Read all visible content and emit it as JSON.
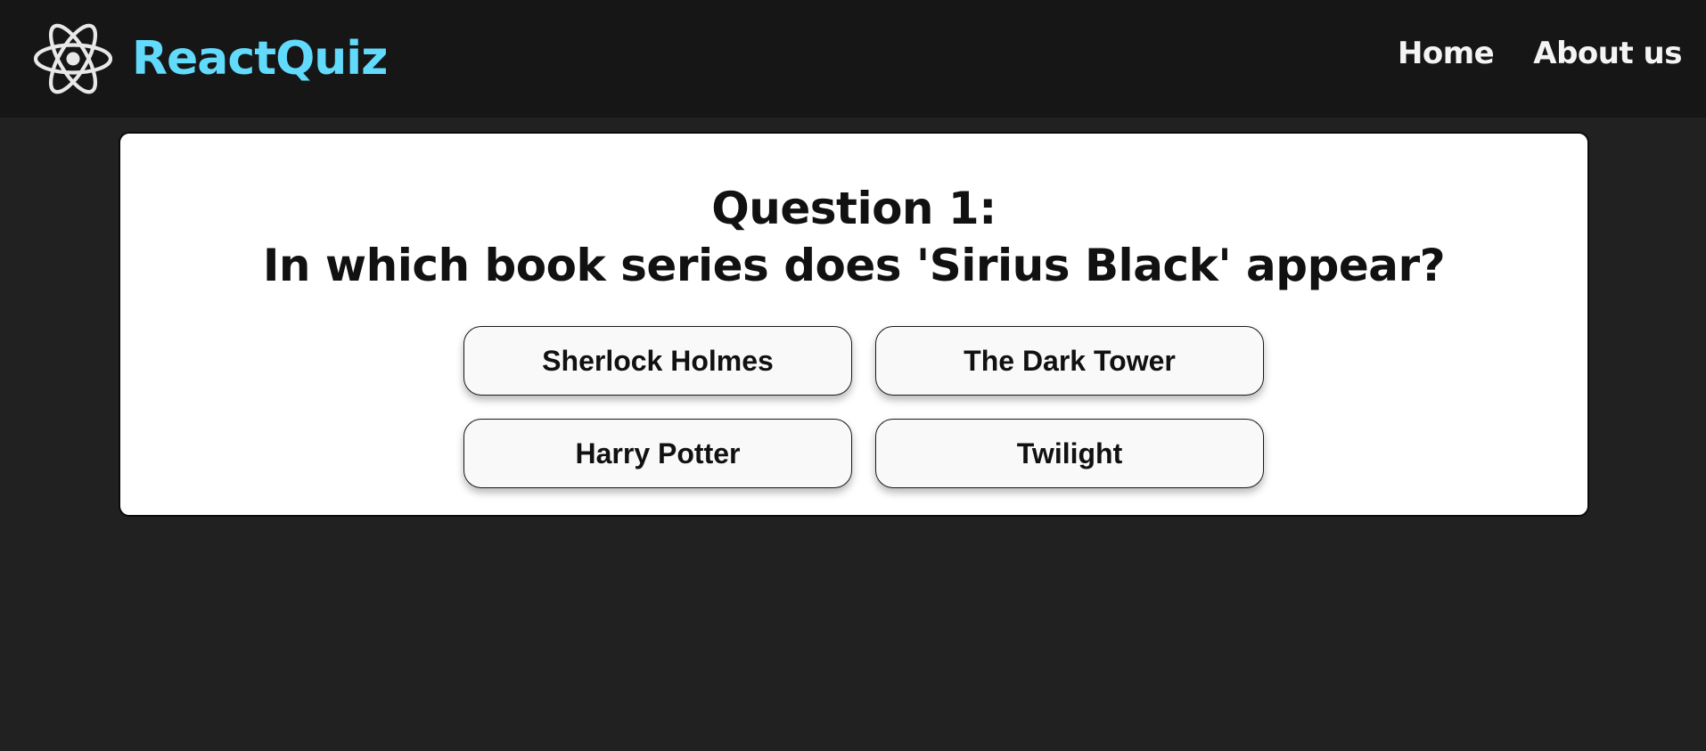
{
  "header": {
    "brand": "ReactQuiz",
    "logo_icon": "react-atom-icon",
    "nav": [
      {
        "label": "Home"
      },
      {
        "label": "About us"
      }
    ]
  },
  "quiz": {
    "question_number": "Question 1:",
    "question_text": "In which book series does 'Sirius Black' appear?",
    "answers": [
      {
        "label": "Sherlock Holmes"
      },
      {
        "label": "The Dark Tower"
      },
      {
        "label": "Harry Potter"
      },
      {
        "label": "Twilight"
      }
    ]
  },
  "colors": {
    "brand": "#61dafb",
    "header_bg": "#161616",
    "page_bg": "#212121",
    "card_bg": "#ffffff",
    "button_bg": "#f9f9f9"
  }
}
